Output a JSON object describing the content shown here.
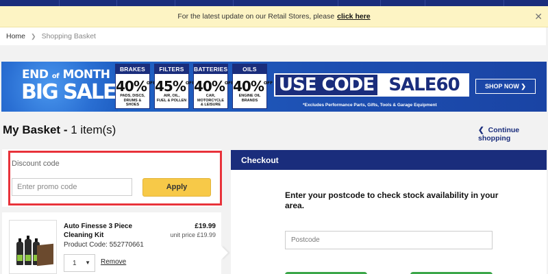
{
  "colors": {
    "brand_navy": "#1a2d7c",
    "notice_bg": "#fdf4c4",
    "apply_yellow": "#f7c948",
    "highlight_red": "#e8323a",
    "checkout_green": "#3aa648"
  },
  "notice": {
    "text": "For the latest update on our Retail Stores, please",
    "link": "click here",
    "close_icon": "close-icon"
  },
  "breadcrumb": {
    "home": "Home",
    "current": "Shopping Basket"
  },
  "promo_banner": {
    "headline_top": "END",
    "headline_of": "of",
    "headline_month": "MONTH",
    "headline_big": "BIG SALE",
    "deals": [
      {
        "category": "BRAKES",
        "percent": "40%",
        "off": "OFF",
        "desc1": "PADS, DISCS,",
        "desc2": "DRUMS & SHOES"
      },
      {
        "category": "FILTERS",
        "percent": "45%",
        "off": "OFF",
        "desc1": "AIR, OIL,",
        "desc2": "FUEL & POLLEN"
      },
      {
        "category": "BATTERIES",
        "percent": "40%",
        "off": "OFF",
        "desc1": "CAR, MOTORCYCLE",
        "desc2": "& LEISURE"
      },
      {
        "category": "OILS",
        "percent": "40%",
        "off": "OFF",
        "desc1": "ENGINE OIL",
        "desc2": "BRANDS"
      }
    ],
    "use_code": "USE CODE",
    "code": "SALE60",
    "shop_now": "SHOP NOW",
    "exclusions": "*Excludes Performance Parts, Gifts, Tools & Garage Equipment"
  },
  "basket": {
    "title": "My Basket -",
    "count": "1 item(s)",
    "continue_label": "Continue shopping"
  },
  "discount": {
    "label": "Discount code",
    "placeholder": "Enter promo code",
    "apply_label": "Apply"
  },
  "items": [
    {
      "name": "Auto Finesse 3 Piece Cleaning Kit",
      "code": "Product Code: 552770661",
      "price": "£19.99",
      "unit_price": "unit price £19.99",
      "qty": "1",
      "remove_label": "Remove"
    }
  ],
  "checkout": {
    "header": "Checkout",
    "prompt": "Enter your postcode to check stock availability in your area.",
    "postcode_placeholder": "Postcode"
  }
}
